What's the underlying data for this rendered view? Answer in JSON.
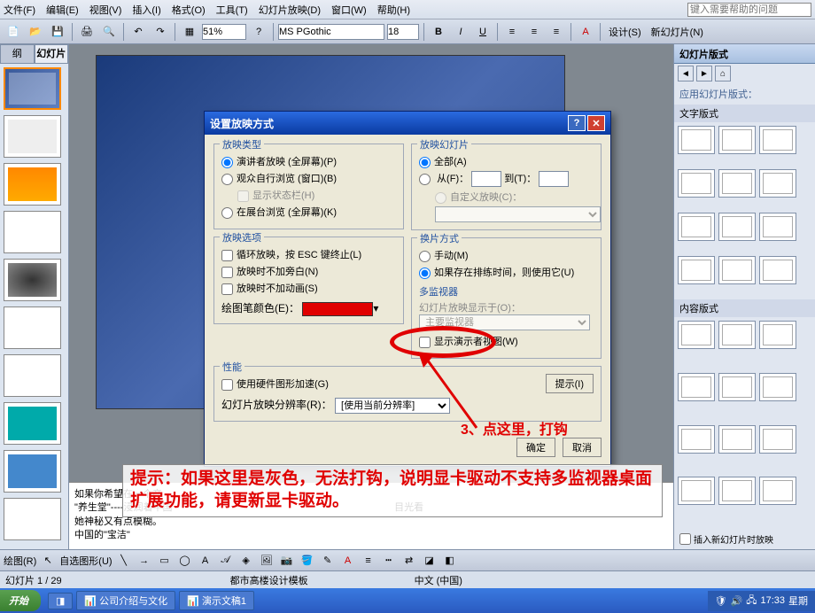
{
  "menu": {
    "file": "文件(F)",
    "edit": "编辑(E)",
    "view": "视图(V)",
    "insert": "插入(I)",
    "format": "格式(O)",
    "tools": "工具(T)",
    "slideshow": "幻灯片放映(D)",
    "window": "窗口(W)",
    "help": "帮助(H)",
    "help_placeholder": "键入需要帮助的问题"
  },
  "toolbar": {
    "zoom": "51%",
    "font_name": "MS PGothic",
    "font_size": "18",
    "design": "设计(S)",
    "new_slide": "新幻灯片(N)"
  },
  "outline": {
    "tab_outline": "纲",
    "tab_slides": "幻灯片"
  },
  "task_pane": {
    "title": "幻灯片版式",
    "apply_label": "应用幻灯片版式：",
    "text_layouts": "文字版式",
    "content_layouts": "内容版式",
    "checkbox": "插入新幻灯片时放映"
  },
  "dialog": {
    "title": "设置放映方式",
    "group_type": "放映类型",
    "type_presenter": "演讲者放映 (全屏幕)(P)",
    "type_browse": "观众自行浏览 (窗口)(B)",
    "type_status": "显示状态栏(H)",
    "type_kiosk": "在展台浏览 (全屏幕)(K)",
    "group_options": "放映选项",
    "opt_loop": "循环放映，按 ESC 键终止(L)",
    "opt_narration": "放映时不加旁白(N)",
    "opt_animation": "放映时不加动画(S)",
    "pen_color": "绘图笔颜色(E)：",
    "group_slides": "放映幻灯片",
    "slides_all": "全部(A)",
    "slides_from": "从(F)：",
    "slides_to": "到(T)：",
    "slides_custom": "自定义放映(C)：",
    "group_advance": "换片方式",
    "advance_manual": "手动(M)",
    "advance_timing": "如果存在排练时间，则使用它(U)",
    "group_monitor": "多监视器",
    "monitor_display": "幻灯片放映显示于(O)：",
    "monitor_primary": "主要监视器",
    "monitor_presenter": "显示演示者视图(W)",
    "group_perf": "性能",
    "perf_hw": "使用硬件图形加速(G)",
    "perf_tip": "提示(I)",
    "perf_res": "幻灯片放映分辨率(R)：",
    "perf_res_val": "[使用当前分辨率]",
    "ok": "确定",
    "cancel": "取消"
  },
  "notes": {
    "line1": "如果你希望在一个产",
    "line2": "\"养生堂\"----浸润着中国",
    "line3": "她神秘又有点模糊。",
    "line4": "中国的\"宝洁\"",
    "line5": "目光看"
  },
  "annotation": {
    "step3": "3、点这里，打钩",
    "hint": "提示：如果这里是灰色，无法打钩，说明显卡驱动不支持多监视器桌面扩展功能，请更新显卡驱动。"
  },
  "drawbar": {
    "draw": "绘图(R)",
    "autoshape": "自选图形(U)"
  },
  "status": {
    "slide_num": "幻灯片 1 / 29",
    "template": "都市高楼设计模板",
    "lang": "中文 (中国)"
  },
  "taskbar": {
    "start": "开始",
    "task1": "公司介绍与文化",
    "task2": "演示文稿1",
    "time": "17:33",
    "day": "星期"
  }
}
